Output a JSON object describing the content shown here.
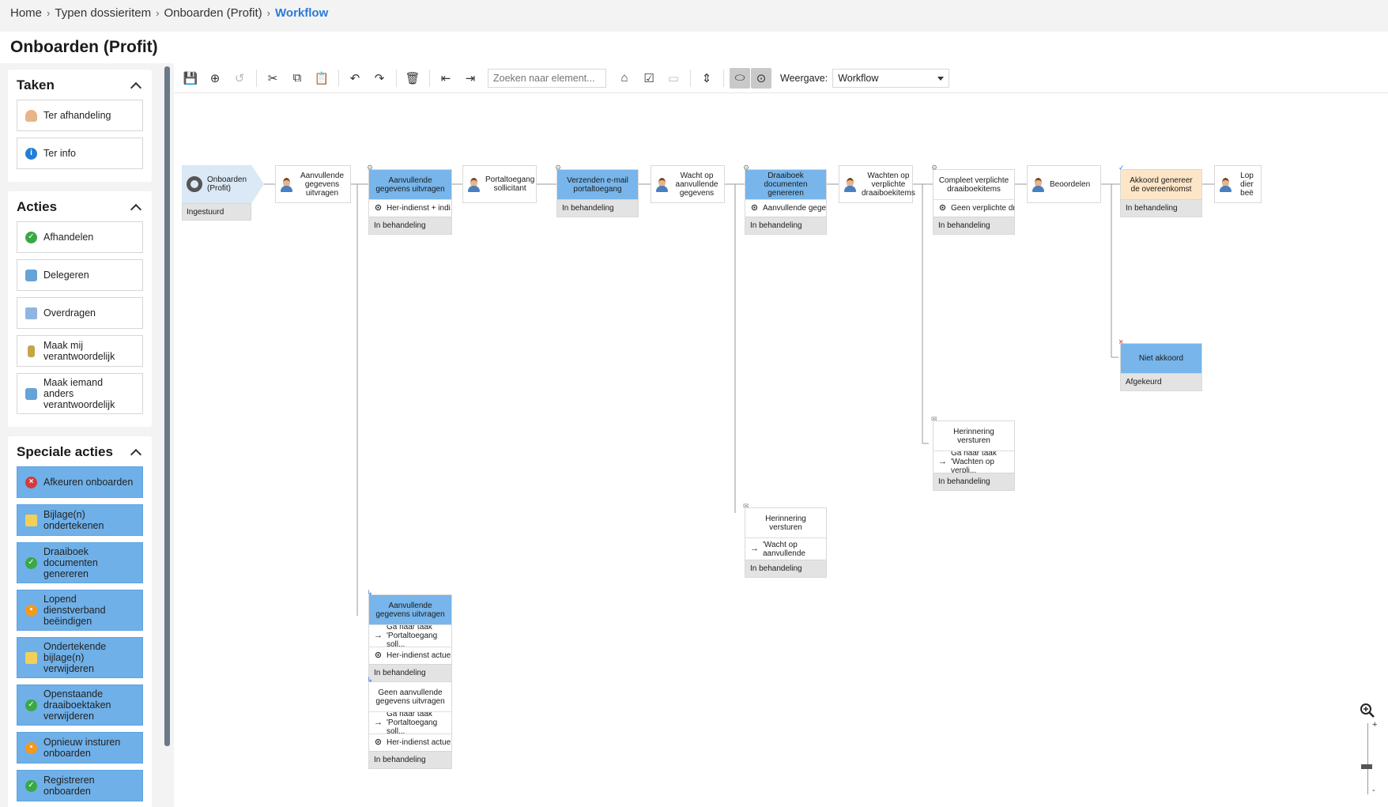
{
  "breadcrumb": {
    "items": [
      "Home",
      "Typen dossieritem",
      "Onboarden (Profit)"
    ],
    "current": "Workflow"
  },
  "page_title": "Onboarden (Profit)",
  "sidebar": {
    "taken": {
      "title": "Taken",
      "items": [
        {
          "label": "Ter afhandeling",
          "icon": "user-icon"
        },
        {
          "label": "Ter info",
          "icon": "info-icon"
        }
      ]
    },
    "acties": {
      "title": "Acties",
      "items": [
        {
          "label": "Afhandelen",
          "icon": "check-icon"
        },
        {
          "label": "Delegeren",
          "icon": "people-icon"
        },
        {
          "label": "Overdragen",
          "icon": "transfer-icon"
        },
        {
          "label": "Maak mij verantwoordelijk",
          "icon": "pin-icon"
        },
        {
          "label": "Maak iemand anders verantwoordelijk",
          "icon": "people-icon"
        }
      ]
    },
    "speciale_acties": {
      "title": "Speciale acties",
      "items": [
        {
          "label": "Afkeuren onboarden",
          "icon": "reject-icon"
        },
        {
          "label": "Bijlage(n) ondertekenen",
          "icon": "document-sign-icon"
        },
        {
          "label": "Draaiboek documenten genereren",
          "icon": "check-icon"
        },
        {
          "label": "Lopend dienstverband beëindigen",
          "icon": "stop-icon"
        },
        {
          "label": "Ondertekende bijlage(n) verwijderen",
          "icon": "document-sign-icon"
        },
        {
          "label": "Openstaande draaiboektaken verwijderen",
          "icon": "check-icon"
        },
        {
          "label": "Opnieuw insturen onboarden",
          "icon": "stop-icon"
        },
        {
          "label": "Registreren onboarden",
          "icon": "check-icon"
        }
      ]
    }
  },
  "toolbar": {
    "search_placeholder": "Zoeken naar element...",
    "view_label": "Weergave:",
    "view_value": "Workflow"
  },
  "workflow": {
    "start": {
      "label": "Onboarden (Profit)",
      "status": "Ingestuurd"
    },
    "nodes": {
      "n1": {
        "label": "Aanvullende gegevens uitvragen"
      },
      "n2": {
        "label": "Aanvullende gegevens uitvragen",
        "row": "Her-indienst + indi...",
        "status": "In behandeling"
      },
      "n3": {
        "label": "Portaltoegang sollicitant"
      },
      "n4": {
        "label": "Verzenden e-mail portaltoegang",
        "status": "In behandeling"
      },
      "n5": {
        "label": "Wacht op aanvullende gegevens"
      },
      "n6": {
        "label": "Draaiboek documenten genereren",
        "row": "Aanvullende gege...",
        "status": "In behandeling"
      },
      "n7": {
        "label": "Wachten op verplichte draaiboekitems"
      },
      "n8": {
        "label": "Compleet verplichte draaiboekitems",
        "row": "Geen verplichte dr...",
        "status": "In behandeling"
      },
      "n9": {
        "label": "Beoordelen"
      },
      "n10": {
        "label": "Akkoord genereer de overeenkomst",
        "status": "In behandeling"
      },
      "n11": {
        "label": "Lop dier beë"
      },
      "n12": {
        "label": "Niet akkoord",
        "status": "Afgekeurd"
      },
      "n13": {
        "label": "Herinnering versturen",
        "row": "Ga naar taak 'Wachten op verpli...",
        "status": "In behandeling"
      },
      "n14": {
        "label": "Herinnering versturen",
        "row": "Ga naar taak 'Wacht op aanvullende ge...",
        "status": "In behandeling"
      },
      "n15": {
        "label": "Aanvullende gegevens uitvragen",
        "row1": "Ga naar taak 'Portaltoegang soll...",
        "row2": "Her-indienst actue...",
        "status": "In behandeling"
      },
      "n16": {
        "label": "Geen aanvullende gegevens uitvragen",
        "row1": "Ga naar taak 'Portaltoegang soll...",
        "row2": "Her-indienst actue...",
        "status": "In behandeling"
      }
    }
  }
}
